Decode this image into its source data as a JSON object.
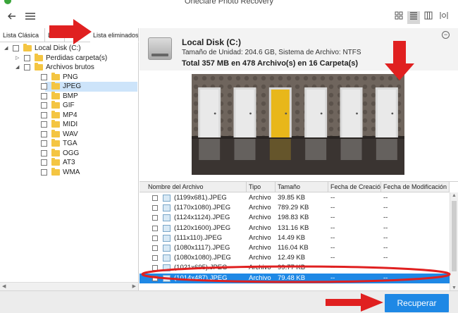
{
  "window": {
    "title": "Oneclare Photo Recovery"
  },
  "toolbar": {
    "icons": [
      "back-icon",
      "menu-icon"
    ],
    "views": [
      "grid-view-icon",
      "list-view-icon",
      "columns-view-icon",
      "info-view-icon"
    ],
    "active_view": "list-view-icon"
  },
  "tabs": [
    "Lista Clásica",
    "Li",
    "Lista eliminados"
  ],
  "tree": [
    {
      "label": "Local Disk (C:)",
      "level": 0,
      "expander": "◢",
      "folder": true
    },
    {
      "label": "Perdidas carpeta(s)",
      "level": 1,
      "expander": "▷",
      "folder": true
    },
    {
      "label": "Archivos brutos",
      "level": 1,
      "expander": "◢",
      "folder": true
    },
    {
      "label": "PNG",
      "level": 2,
      "expander": "",
      "folder": true
    },
    {
      "label": "JPEG",
      "level": 2,
      "expander": "",
      "folder": true,
      "selected": true
    },
    {
      "label": "BMP",
      "level": 2,
      "expander": "",
      "folder": true
    },
    {
      "label": "GIF",
      "level": 2,
      "expander": "",
      "folder": true
    },
    {
      "label": "MP4",
      "level": 2,
      "expander": "",
      "folder": true
    },
    {
      "label": "MIDI",
      "level": 2,
      "expander": "",
      "folder": true
    },
    {
      "label": "WAV",
      "level": 2,
      "expander": "",
      "folder": true
    },
    {
      "label": "TGA",
      "level": 2,
      "expander": "",
      "folder": true
    },
    {
      "label": "OGG",
      "level": 2,
      "expander": "",
      "folder": true
    },
    {
      "label": "AT3",
      "level": 2,
      "expander": "",
      "folder": true
    },
    {
      "label": "WMA",
      "level": 2,
      "expander": "",
      "folder": true
    }
  ],
  "disk": {
    "name": "Local Disk (C:)",
    "details": "Tamaño de Unidad: 204.6 GB, Sistema de Archivo: NTFS",
    "total": "Total 357 MB en 478 Archivo(s) en 16 Carpeta(s)"
  },
  "preview": {
    "door_colors": [
      "#e9e9e9",
      "#e9e9e9",
      "#e8b71a",
      "#e9e9e9",
      "#e9e9e9",
      "#e9e9e9"
    ]
  },
  "table": {
    "columns": [
      "Nombre del Archivo",
      "Tipo",
      "Tamaño",
      "Fecha de Creación",
      "Fecha de Modificación"
    ],
    "rows": [
      {
        "name": "(1199x681).JPEG",
        "type": "Archivo",
        "size": "39.85 KB",
        "created": "--",
        "modified": "--"
      },
      {
        "name": "(1170x1080).JPEG",
        "type": "Archivo",
        "size": "789.29 KB",
        "created": "--",
        "modified": "--"
      },
      {
        "name": "(1124x1124).JPEG",
        "type": "Archivo",
        "size": "198.83 KB",
        "created": "--",
        "modified": "--"
      },
      {
        "name": "(1120x1600).JPEG",
        "type": "Archivo",
        "size": "131.16 KB",
        "created": "--",
        "modified": "--"
      },
      {
        "name": "(111x110).JPEG",
        "type": "Archivo",
        "size": "14.49 KB",
        "created": "--",
        "modified": "--"
      },
      {
        "name": "(1080x1117).JPEG",
        "type": "Archivo",
        "size": "116.04 KB",
        "created": "--",
        "modified": "--"
      },
      {
        "name": "(1080x1080).JPEG",
        "type": "Archivo",
        "size": "12.49 KB",
        "created": "--",
        "modified": "--"
      },
      {
        "name": "(1021x695).JPEG",
        "type": "Archivo",
        "size": "99.77 KB",
        "created": "--",
        "modified": "--"
      },
      {
        "name": "(1014x487).JPEG",
        "type": "Archivo",
        "size": "79.48 KB",
        "created": "--",
        "modified": "--",
        "selected": true
      }
    ]
  },
  "actions": {
    "recover": "Recuperar"
  },
  "colors": {
    "accent": "#1e88e5",
    "annotation": "#e02020",
    "selection": "#cde4fa"
  }
}
